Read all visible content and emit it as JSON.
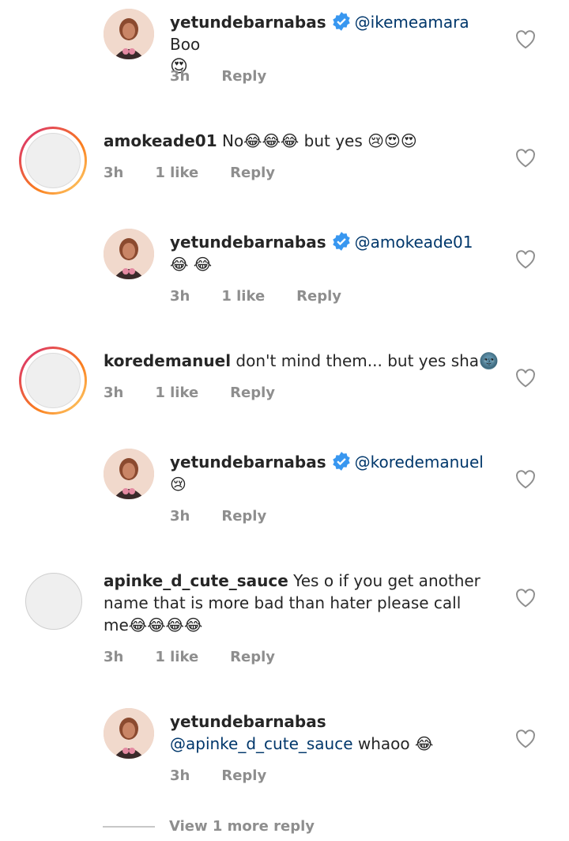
{
  "comments": [
    {
      "user": "yetundebarnabas",
      "verified": true,
      "mention": "@ikemeamara",
      "text": " Boo ",
      "emoji": "😍",
      "time": "3h",
      "likes": "",
      "reply": "Reply"
    },
    {
      "user": "amokeade01",
      "verified": false,
      "mention": "",
      "text": " No😂😂😂 but yes 😢😍😍",
      "time": "3h",
      "likes": "1 like",
      "reply": "Reply"
    },
    {
      "user": "yetundebarnabas",
      "verified": true,
      "mention": "@amokeade01",
      "text": " 😂 😂",
      "time": "3h",
      "likes": "1 like",
      "reply": "Reply"
    },
    {
      "user": "koredemanuel",
      "verified": false,
      "mention": "",
      "text": " don't mind them... but yes sha🌚",
      "time": "3h",
      "likes": "1 like",
      "reply": "Reply"
    },
    {
      "user": "yetundebarnabas",
      "verified": true,
      "mention": "@koredemanuel",
      "text": " 😢",
      "time": "3h",
      "likes": "",
      "reply": "Reply"
    },
    {
      "user": "apinke_d_cute_sauce",
      "verified": false,
      "mention": "",
      "text": " Yes o if you get another name that is more bad than  hater please call me😂😂😂😂",
      "time": "3h",
      "likes": "1 like",
      "reply": "Reply"
    },
    {
      "user": "yetundebarnabas",
      "verified": false,
      "mention": "@apinke_d_cute_sauce",
      "text": " whaoo 😂",
      "time": "3h",
      "likes": "",
      "reply": "Reply"
    }
  ],
  "view_more": "View 1 more reply"
}
